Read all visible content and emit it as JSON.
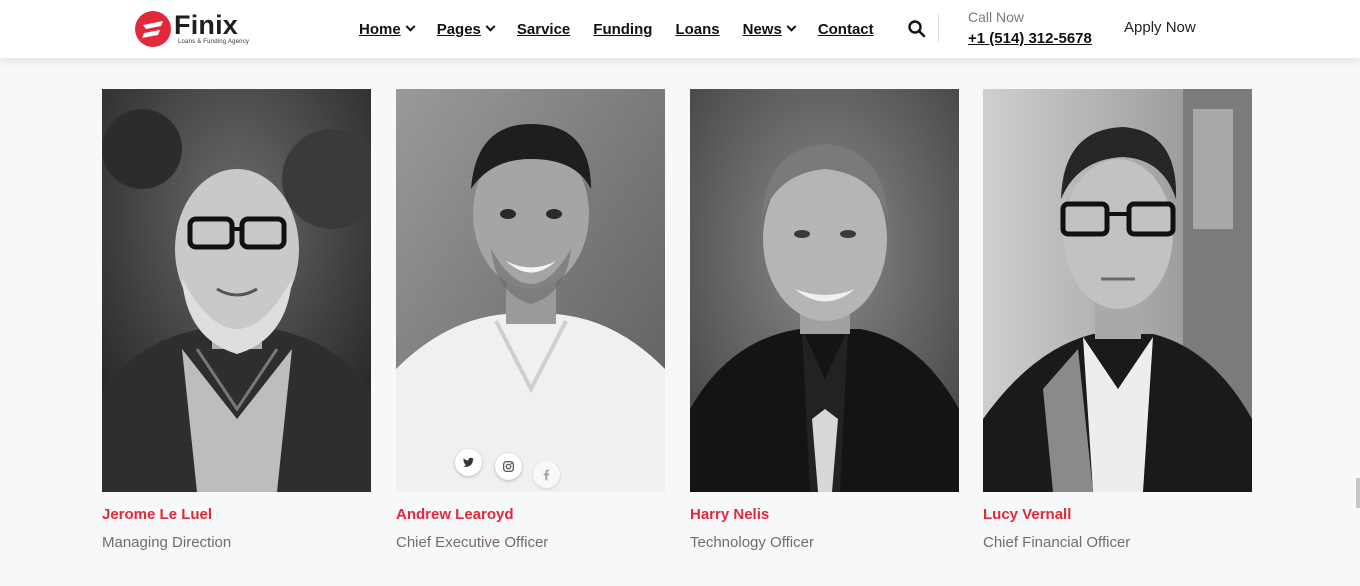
{
  "brand": {
    "name": "Finix",
    "tagline": "Loans & Funding Agency",
    "accent_color": "#e3283a"
  },
  "nav": {
    "items": [
      {
        "label": "Home",
        "has_dropdown": true
      },
      {
        "label": "Pages",
        "has_dropdown": true
      },
      {
        "label": "Sarvice",
        "has_dropdown": false
      },
      {
        "label": "Funding",
        "has_dropdown": false
      },
      {
        "label": "Loans",
        "has_dropdown": false
      },
      {
        "label": "News",
        "has_dropdown": true
      },
      {
        "label": "Contact",
        "has_dropdown": false
      }
    ],
    "search_icon": "search-icon"
  },
  "contact": {
    "call_label": "Call Now",
    "phone": "+1 (514) 312-5678"
  },
  "cta": {
    "apply_label": "Apply Now"
  },
  "team": {
    "members": [
      {
        "name": "Jerome Le Luel",
        "role": "Managing Direction"
      },
      {
        "name": "Andrew Learoyd",
        "role": "Chief Executive Officer"
      },
      {
        "name": "Harry Nelis",
        "role": "Technology Officer"
      },
      {
        "name": "Lucy Vernall",
        "role": "Chief Financial Officer"
      }
    ],
    "social_icons": [
      "twitter-icon",
      "instagram-icon",
      "facebook-icon"
    ]
  }
}
